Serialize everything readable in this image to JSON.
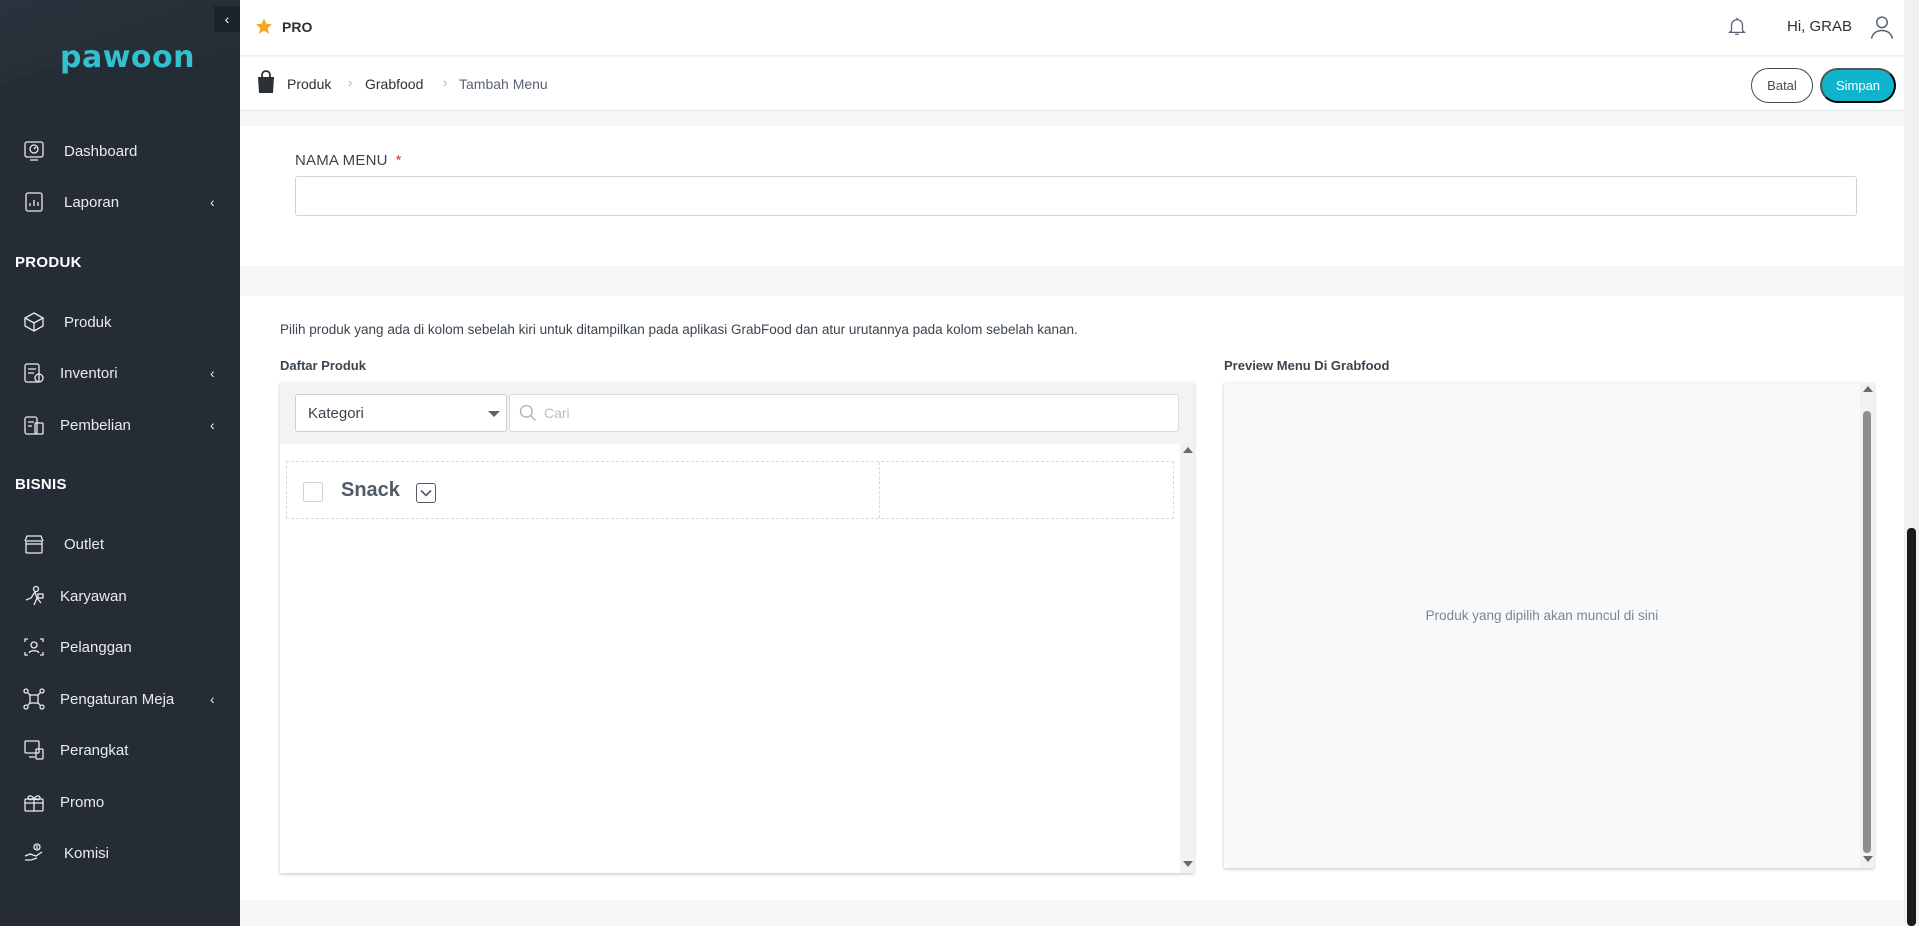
{
  "sidebar": {
    "logo": "pawoon",
    "collapse_icon": "chevron-left-icon",
    "items": [
      {
        "label": "Dashboard",
        "icon": "dashboard-icon"
      },
      {
        "label": "Laporan",
        "icon": "report-icon",
        "expandable": true
      },
      {
        "label": "Produk",
        "icon": "box-icon"
      },
      {
        "label": "Inventori",
        "icon": "inventory-icon",
        "expandable": true
      },
      {
        "label": "Pembelian",
        "icon": "purchase-icon",
        "expandable": true
      },
      {
        "label": "Outlet",
        "icon": "store-icon"
      },
      {
        "label": "Karyawan",
        "icon": "employee-icon"
      },
      {
        "label": "Pelanggan",
        "icon": "customer-icon"
      },
      {
        "label": "Pengaturan Meja",
        "icon": "table-icon",
        "expandable": true
      },
      {
        "label": "Perangkat",
        "icon": "device-icon"
      },
      {
        "label": "Promo",
        "icon": "gift-icon"
      },
      {
        "label": "Komisi",
        "icon": "commission-icon"
      }
    ],
    "sections": {
      "produk": "PRODUK",
      "bisnis": "BISNIS"
    }
  },
  "header": {
    "badge": "PRO",
    "greeting": "Hi, GRAB",
    "accent": "#10b3cc",
    "star_color": "#f5a623"
  },
  "breadcrumb": {
    "items": [
      "Produk",
      "Grabfood",
      "Tambah Menu"
    ],
    "batal_label": "Batal",
    "simpan_label": "Simpan"
  },
  "form": {
    "nama_menu_label": "NAMA MENU",
    "required_mark": "*",
    "nama_menu_value": ""
  },
  "product_picker": {
    "help_text": "Pilih produk yang ada di kolom sebelah kiri untuk ditampilkan pada aplikasi GrabFood dan atur urutannya pada kolom sebelah kanan.",
    "list_title": "Daftar Produk",
    "preview_title": "Preview Menu Di Grabfood",
    "category_select": "Kategori",
    "search_placeholder": "Cari",
    "categories": [
      {
        "name": "Snack",
        "checked": false
      }
    ],
    "preview_empty": "Produk yang dipilih akan muncul di sini"
  }
}
